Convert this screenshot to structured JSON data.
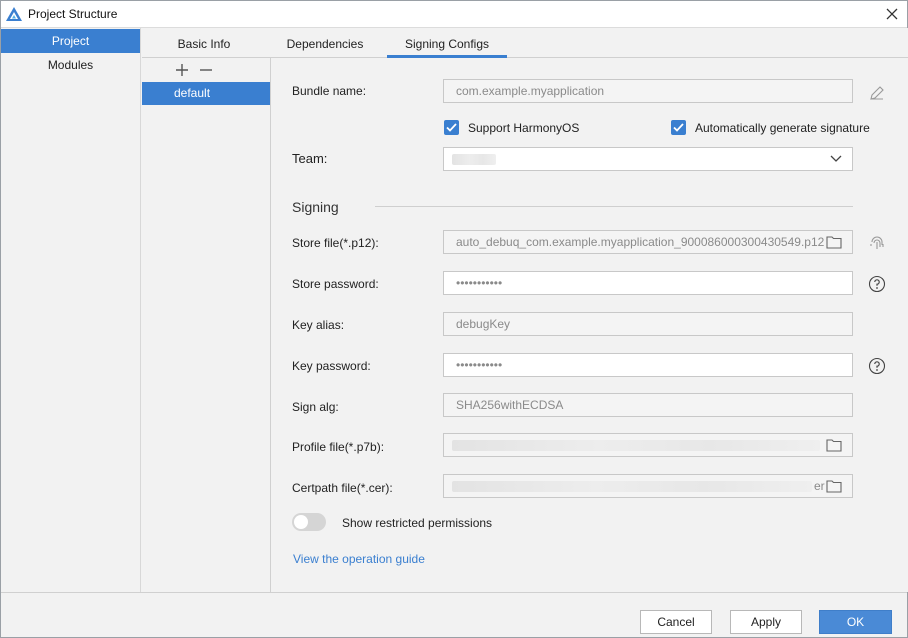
{
  "window": {
    "title": "Project Structure",
    "close_icon": "close-icon",
    "app_icon": "harmony-app-icon"
  },
  "sidebar": {
    "items": [
      {
        "label": "Project",
        "active": true
      },
      {
        "label": "Modules",
        "active": false
      }
    ]
  },
  "tabs": [
    {
      "label": "Basic Info",
      "active": false
    },
    {
      "label": "Dependencies",
      "active": false
    },
    {
      "label": "Signing Configs",
      "active": true
    }
  ],
  "configs": {
    "add_icon": "plus-icon",
    "remove_icon": "minus-icon",
    "items": [
      {
        "label": "default",
        "selected": true
      }
    ]
  },
  "form": {
    "bundle_name": {
      "label": "Bundle name:",
      "value": "com.example.myapplication",
      "edit_icon": "pencil-icon"
    },
    "support_harmony": {
      "label": "Support HarmonyOS",
      "checked": true
    },
    "auto_sign": {
      "label": "Automatically generate signature",
      "checked": true
    },
    "team": {
      "label": "Team:",
      "value": "",
      "dropdown_icon": "chevron-down-icon"
    },
    "section_title": "Signing",
    "store_file": {
      "label": "Store file(*.p12):",
      "value": "auto_debuq_com.example.myapplication_900086000300430549.p12",
      "folder_icon": "folder-icon",
      "side_icon": "fingerprint-icon"
    },
    "store_password": {
      "label": "Store password:",
      "value": "•••••••••••",
      "side_icon": "help-icon"
    },
    "key_alias": {
      "label": "Key alias:",
      "value": "debugKey"
    },
    "key_password": {
      "label": "Key password:",
      "value": "•••••••••••",
      "side_icon": "help-icon"
    },
    "sign_alg": {
      "label": "Sign alg:",
      "value": "SHA256withECDSA"
    },
    "profile_file": {
      "label": "Profile file(*.p7b):",
      "value": "",
      "folder_icon": "folder-icon"
    },
    "certpath_file": {
      "label": "Certpath file(*.cer):",
      "value": "er",
      "folder_icon": "folder-icon"
    },
    "restricted": {
      "label": "Show restricted permissions",
      "enabled": false
    },
    "guide_link": "View the operation guide"
  },
  "footer": {
    "cancel": "Cancel",
    "apply": "Apply",
    "ok": "OK"
  },
  "colors": {
    "accent": "#3a7fd0",
    "background": "#f2f2f2",
    "link": "#3a7fd0"
  }
}
